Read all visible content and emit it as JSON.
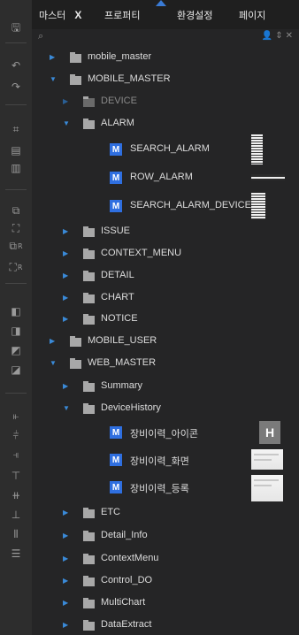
{
  "tabs": [
    {
      "label": "마스터",
      "close": "X"
    },
    {
      "label": "프로퍼티"
    },
    {
      "label": "환경설정"
    },
    {
      "label": "페이지"
    }
  ],
  "search": {
    "icon": "search-icon",
    "right_icons": "user-icon sort-icon close-icon"
  },
  "toolbar": {
    "items": [
      {
        "name": "save-icon",
        "glyph": "🖫"
      },
      {
        "name": "undo-icon",
        "glyph": "↶"
      },
      {
        "name": "redo-icon",
        "glyph": "↷"
      },
      {
        "name": "crop-icon",
        "glyph": "⌗"
      },
      {
        "name": "copy-icon",
        "glyph": "▤"
      },
      {
        "name": "paste-icon",
        "glyph": "▥"
      },
      {
        "name": "group-icon",
        "glyph": "⧉"
      },
      {
        "name": "ungroup-icon",
        "glyph": "⛶"
      },
      {
        "name": "group-r-icon",
        "glyph": "⧉",
        "sub": "R"
      },
      {
        "name": "ungroup-r-icon",
        "glyph": "⛶",
        "sub": "R"
      },
      {
        "name": "bring-front-icon",
        "glyph": "◧"
      },
      {
        "name": "send-back-icon",
        "glyph": "◨"
      },
      {
        "name": "bring-forward-icon",
        "glyph": "◩"
      },
      {
        "name": "send-backward-icon",
        "glyph": "◪"
      },
      {
        "name": "align-left-icon",
        "glyph": "⫦"
      },
      {
        "name": "align-center-icon",
        "glyph": "⫩"
      },
      {
        "name": "align-right-icon",
        "glyph": "⫣"
      },
      {
        "name": "align-top-icon",
        "glyph": "⊤"
      },
      {
        "name": "align-middle-icon",
        "glyph": "⧺"
      },
      {
        "name": "align-bottom-icon",
        "glyph": "⊥"
      },
      {
        "name": "distribute-h-icon",
        "glyph": "⫴"
      },
      {
        "name": "distribute-v-icon",
        "glyph": "☰"
      }
    ]
  },
  "tree": [
    {
      "label": "mobile_master",
      "level": 1,
      "type": "folder",
      "state": "collapsed"
    },
    {
      "label": "MOBILE_MASTER",
      "level": 1,
      "type": "folder",
      "state": "expanded"
    },
    {
      "label": "DEVICE",
      "level": 2,
      "type": "folder",
      "state": "collapsed",
      "dim": true
    },
    {
      "label": "ALARM",
      "level": 2,
      "type": "folder",
      "state": "expanded"
    },
    {
      "label": "SEARCH_ALARM",
      "level": 3,
      "type": "page",
      "badge": "M"
    },
    {
      "label": "ROW_ALARM",
      "level": 3,
      "type": "page",
      "badge": "M"
    },
    {
      "label": "SEARCH_ALARM_DEVICE",
      "level": 3,
      "type": "page",
      "badge": "M"
    },
    {
      "label": "ISSUE",
      "level": 2,
      "type": "folder",
      "state": "collapsed"
    },
    {
      "label": "CONTEXT_MENU",
      "level": 2,
      "type": "folder",
      "state": "collapsed"
    },
    {
      "label": "DETAIL",
      "level": 2,
      "type": "folder",
      "state": "collapsed"
    },
    {
      "label": "CHART",
      "level": 2,
      "type": "folder",
      "state": "collapsed"
    },
    {
      "label": "NOTICE",
      "level": 2,
      "type": "folder",
      "state": "collapsed"
    },
    {
      "label": "MOBILE_USER",
      "level": 1,
      "type": "folder",
      "state": "collapsed"
    },
    {
      "label": "WEB_MASTER",
      "level": 1,
      "type": "folder",
      "state": "expanded"
    },
    {
      "label": "Summary",
      "level": 2,
      "type": "folder",
      "state": "collapsed"
    },
    {
      "label": "DeviceHistory",
      "level": 2,
      "type": "folder",
      "state": "expanded"
    },
    {
      "label": "장비이력_아이콘",
      "level": 3,
      "type": "page",
      "badge": "M",
      "thumb_letter": "H"
    },
    {
      "label": "장비이력_화면",
      "level": 3,
      "type": "page",
      "badge": "M"
    },
    {
      "label": "장비이력_등록",
      "level": 3,
      "type": "page",
      "badge": "M"
    },
    {
      "label": "ETC",
      "level": 2,
      "type": "folder",
      "state": "collapsed"
    },
    {
      "label": "Detail_Info",
      "level": 2,
      "type": "folder",
      "state": "collapsed"
    },
    {
      "label": "ContextMenu",
      "level": 2,
      "type": "folder",
      "state": "collapsed"
    },
    {
      "label": "Control_DO",
      "level": 2,
      "type": "folder",
      "state": "collapsed"
    },
    {
      "label": "MultiChart",
      "level": 2,
      "type": "folder",
      "state": "collapsed"
    },
    {
      "label": "DataExtract",
      "level": 2,
      "type": "folder",
      "state": "collapsed"
    }
  ],
  "colors": {
    "accent": "#3a8ad8",
    "badge": "#2f6fe0",
    "background": "#252526",
    "text": "#dcdcdc"
  }
}
